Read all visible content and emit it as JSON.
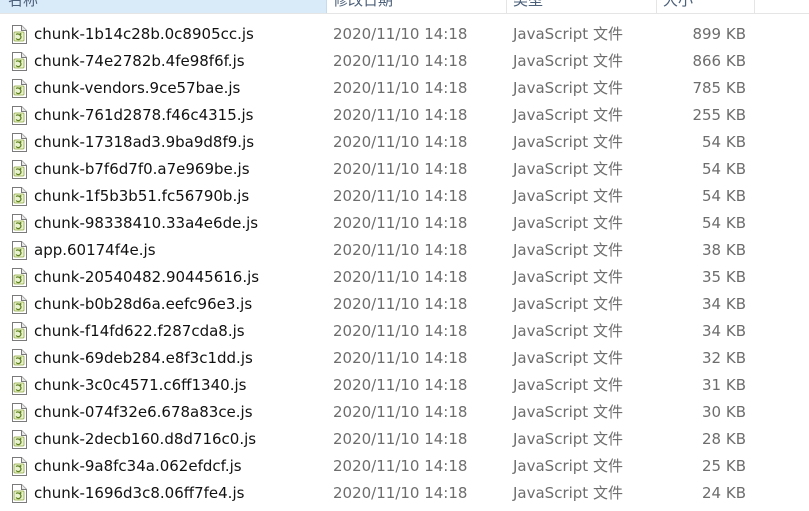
{
  "header": {
    "name": "名称",
    "date": "修改日期",
    "type": "类型",
    "size": "大小"
  },
  "icon": "javascript-file-icon",
  "files": [
    {
      "name": "chunk-1b14c28b.0c8905cc.js",
      "date": "2020/11/10 14:18",
      "type": "JavaScript 文件",
      "size": "899 KB"
    },
    {
      "name": "chunk-74e2782b.4fe98f6f.js",
      "date": "2020/11/10 14:18",
      "type": "JavaScript 文件",
      "size": "866 KB"
    },
    {
      "name": "chunk-vendors.9ce57bae.js",
      "date": "2020/11/10 14:18",
      "type": "JavaScript 文件",
      "size": "785 KB"
    },
    {
      "name": "chunk-761d2878.f46c4315.js",
      "date": "2020/11/10 14:18",
      "type": "JavaScript 文件",
      "size": "255 KB"
    },
    {
      "name": "chunk-17318ad3.9ba9d8f9.js",
      "date": "2020/11/10 14:18",
      "type": "JavaScript 文件",
      "size": "54 KB"
    },
    {
      "name": "chunk-b7f6d7f0.a7e969be.js",
      "date": "2020/11/10 14:18",
      "type": "JavaScript 文件",
      "size": "54 KB"
    },
    {
      "name": "chunk-1f5b3b51.fc56790b.js",
      "date": "2020/11/10 14:18",
      "type": "JavaScript 文件",
      "size": "54 KB"
    },
    {
      "name": "chunk-98338410.33a4e6de.js",
      "date": "2020/11/10 14:18",
      "type": "JavaScript 文件",
      "size": "54 KB"
    },
    {
      "name": "app.60174f4e.js",
      "date": "2020/11/10 14:18",
      "type": "JavaScript 文件",
      "size": "38 KB"
    },
    {
      "name": "chunk-20540482.90445616.js",
      "date": "2020/11/10 14:18",
      "type": "JavaScript 文件",
      "size": "35 KB"
    },
    {
      "name": "chunk-b0b28d6a.eefc96e3.js",
      "date": "2020/11/10 14:18",
      "type": "JavaScript 文件",
      "size": "34 KB"
    },
    {
      "name": "chunk-f14fd622.f287cda8.js",
      "date": "2020/11/10 14:18",
      "type": "JavaScript 文件",
      "size": "34 KB"
    },
    {
      "name": "chunk-69deb284.e8f3c1dd.js",
      "date": "2020/11/10 14:18",
      "type": "JavaScript 文件",
      "size": "32 KB"
    },
    {
      "name": "chunk-3c0c4571.c6ff1340.js",
      "date": "2020/11/10 14:18",
      "type": "JavaScript 文件",
      "size": "31 KB"
    },
    {
      "name": "chunk-074f32e6.678a83ce.js",
      "date": "2020/11/10 14:18",
      "type": "JavaScript 文件",
      "size": "30 KB"
    },
    {
      "name": "chunk-2decb160.d8d716c0.js",
      "date": "2020/11/10 14:18",
      "type": "JavaScript 文件",
      "size": "28 KB"
    },
    {
      "name": "chunk-9a8fc34a.062efdcf.js",
      "date": "2020/11/10 14:18",
      "type": "JavaScript 文件",
      "size": "25 KB"
    },
    {
      "name": "chunk-1696d3c8.06ff7fe4.js",
      "date": "2020/11/10 14:18",
      "type": "JavaScript 文件",
      "size": "24 KB"
    }
  ]
}
